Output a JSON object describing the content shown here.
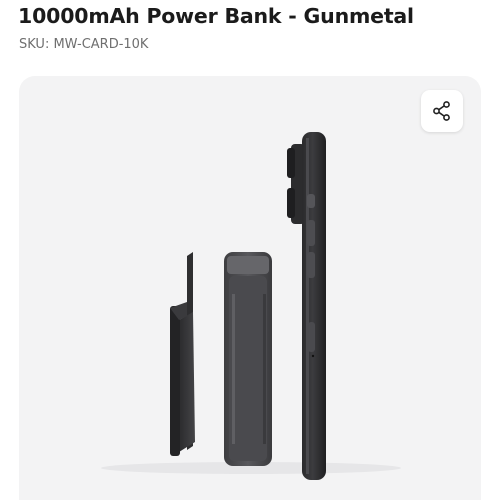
{
  "product": {
    "title": "10000mAh Power Bank - Gunmetal",
    "sku": "SKU: MW-CARD-10K"
  },
  "gallery": {
    "share_icon": "share-icon",
    "background_color": "#f3f3f4"
  }
}
